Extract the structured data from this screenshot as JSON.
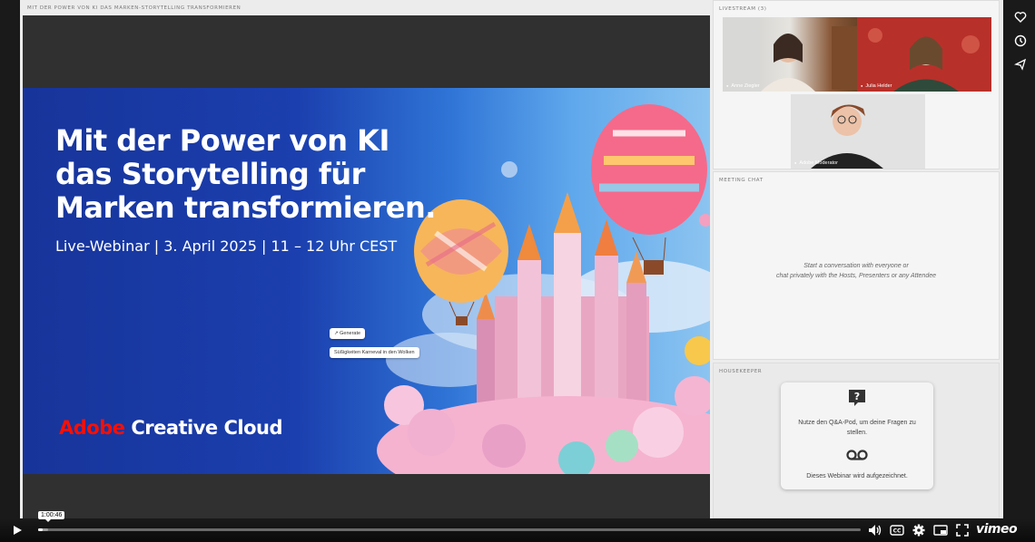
{
  "share_pod": {
    "title": "MIT DER POWER VON KI DAS MARKEN-STORYTELLING TRANSFORMIEREN",
    "slide": {
      "headline": "Mit der Power von KI das Storytelling für Marken transformieren.",
      "subtitle": "Live-Webinar | 3. April 2025 | 11 – 12 Uhr CEST",
      "logo_part1": "Adobe",
      "logo_part2": "Creative Cloud",
      "chip_generate": "Generate",
      "chip_prompt": "Süßigkeiten Karneval in den Wolken"
    }
  },
  "livestream": {
    "title": "LIVESTREAM (3)",
    "participants": [
      {
        "name": "Anne Ziegler"
      },
      {
        "name": "Julia Helder"
      },
      {
        "name": "Adobe Moderator"
      }
    ]
  },
  "chat": {
    "title": "MEETING CHAT",
    "empty_line1": "Start a conversation with everyone or",
    "empty_line2": "chat privately with the Hosts, Presenters or any Attendee"
  },
  "housekeeper": {
    "title": "HOUSEKEEPER",
    "qa_text": "Nutze den Q&A-Pod, um deine Fragen zu stellen.",
    "record_text": "Dieses Webinar wird aufgezeichnet.",
    "qa_icon": "question-bubble-icon",
    "record_icon": "voicemail-icon"
  },
  "player": {
    "time_tooltip": "1:00:46",
    "brand": "vimeo",
    "progress_fraction": 0.005,
    "buffer_fraction": 0.012,
    "side_icons": [
      "heart-icon",
      "clock-icon",
      "share-icon"
    ],
    "control_icons": [
      "play-icon",
      "volume-icon",
      "captions-icon",
      "settings-icon",
      "pip-icon",
      "fullscreen-icon"
    ]
  }
}
